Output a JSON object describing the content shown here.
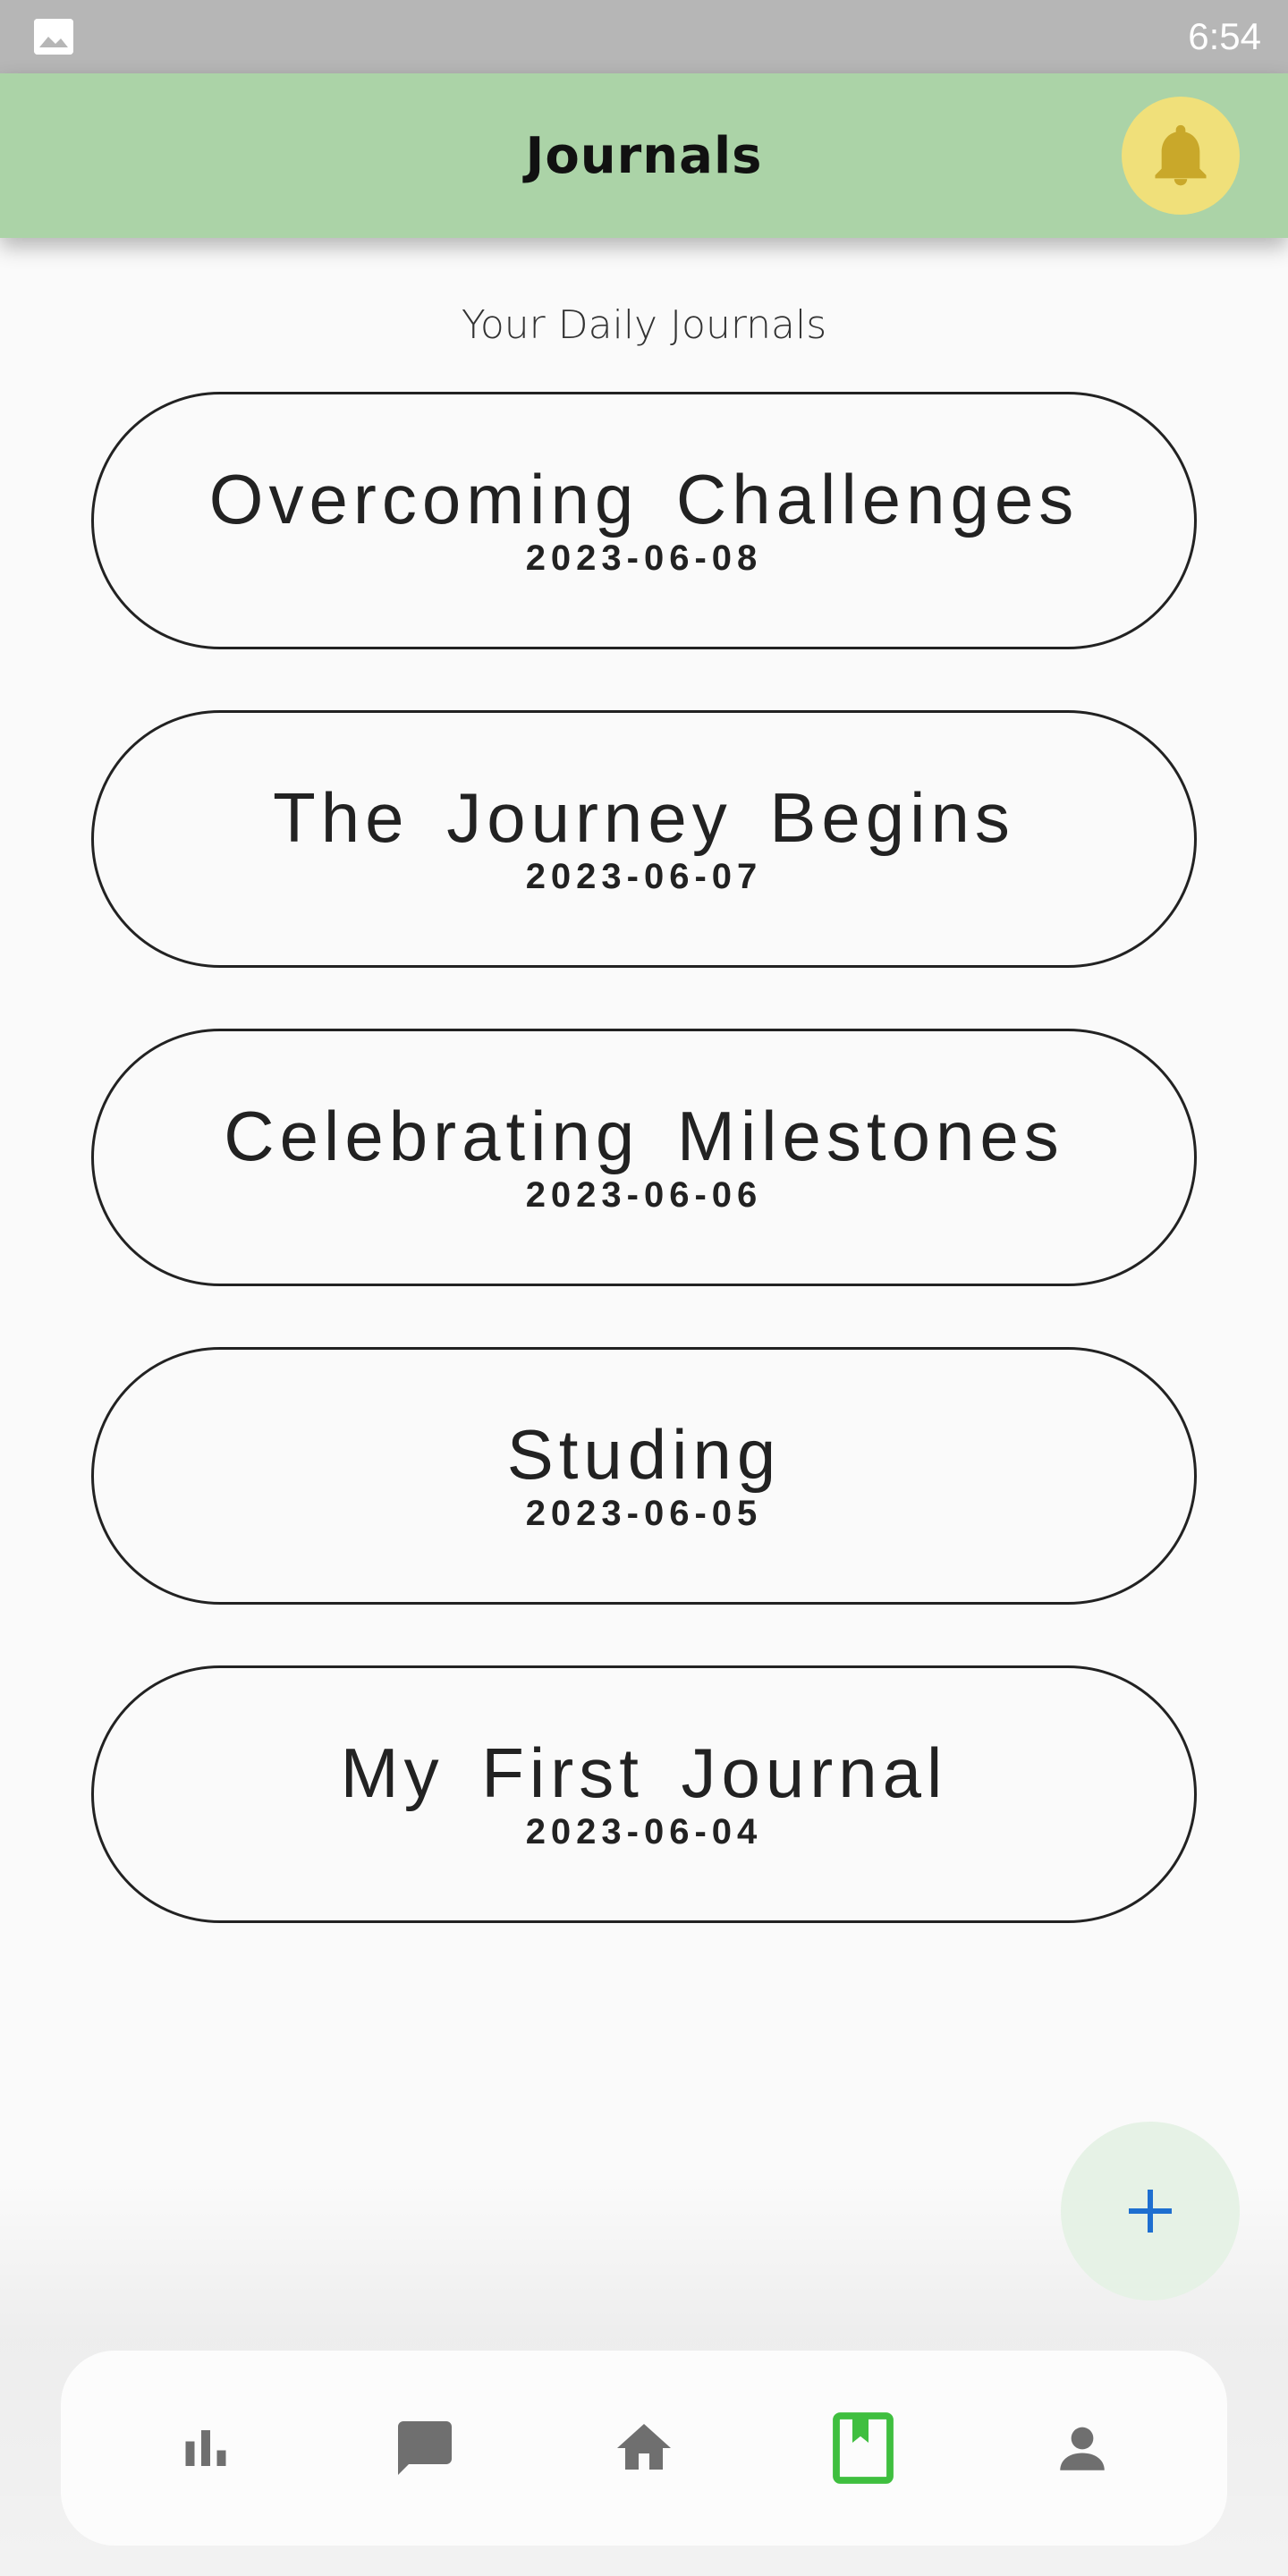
{
  "status_bar": {
    "time": "6:54",
    "left_icon": "image-icon"
  },
  "app_bar": {
    "title": "Journals",
    "notification_icon": "bell-icon",
    "bell_bg": "#f0e07a",
    "bar_bg": "#abd3a7"
  },
  "main": {
    "subtitle": "Your Daily Journals",
    "journals": [
      {
        "title": "Overcoming Challenges",
        "date": "2023-06-08"
      },
      {
        "title": "The Journey Begins",
        "date": "2023-06-07"
      },
      {
        "title": "Celebrating Milestones",
        "date": "2023-06-06"
      },
      {
        "title": "Studing",
        "date": "2023-06-05"
      },
      {
        "title": "My First Journal",
        "date": "2023-06-04"
      }
    ]
  },
  "fab": {
    "icon": "plus-icon",
    "icon_color": "#1e6fd0"
  },
  "bottom_nav": {
    "items": [
      {
        "icon": "bar-chart-icon",
        "active": false
      },
      {
        "icon": "chat-icon",
        "active": false
      },
      {
        "icon": "home-icon",
        "active": false
      },
      {
        "icon": "journal-bookmark-icon",
        "active": true
      },
      {
        "icon": "person-icon",
        "active": false
      }
    ],
    "active_color": "#3fbf3f",
    "inactive_color": "#6f6f6f"
  }
}
